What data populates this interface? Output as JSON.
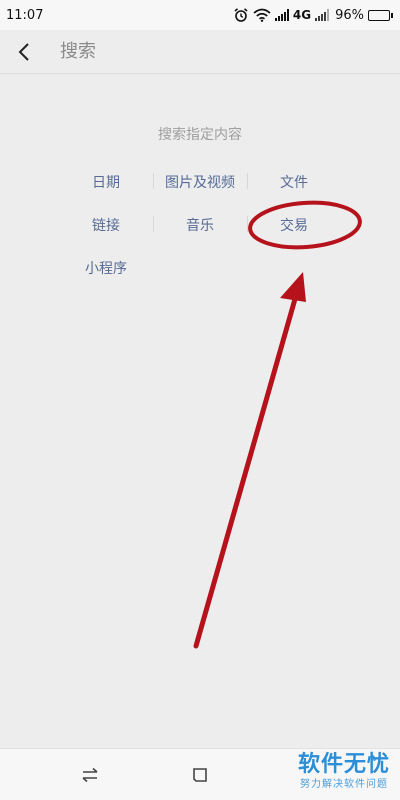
{
  "status_bar": {
    "time": "11:07",
    "network": "4G",
    "battery": "96%",
    "battery_level": 0.96,
    "icons": [
      "alarm-icon",
      "wifi-icon",
      "signal-icon",
      "battery-icon"
    ]
  },
  "header": {
    "back_icon": "chevron-left-icon",
    "search_placeholder": "搜索"
  },
  "content": {
    "hint": "搜索指定内容",
    "categories": [
      "日期",
      "图片及视频",
      "文件",
      "链接",
      "音乐",
      "交易",
      "小程序"
    ]
  },
  "annotation": {
    "color": "#b5121b",
    "circled_item": "交易"
  },
  "navbar": {
    "icons": [
      "switch-arrows-icon",
      "square-home-icon"
    ]
  },
  "watermark": {
    "title": "软件无忧",
    "subtitle": "努力解决软件问题"
  },
  "colors": {
    "link": "#576b95",
    "background": "#ededed",
    "watermark": "#2b8fd8"
  }
}
